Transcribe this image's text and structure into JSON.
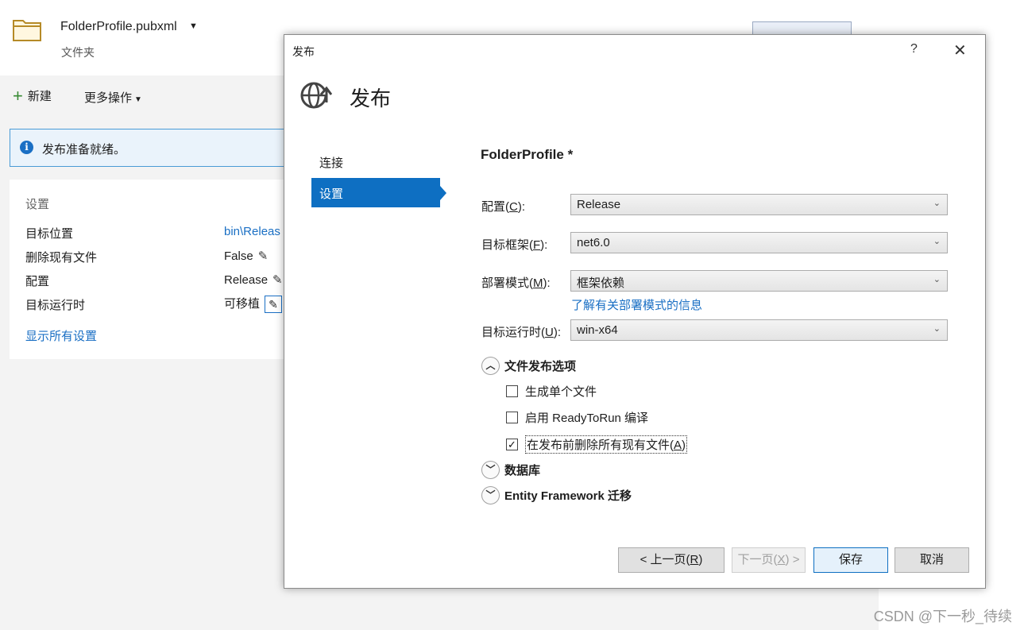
{
  "background": {
    "profile_name": "FolderProfile.pubxml",
    "profile_type": "文件夹",
    "toolbar": {
      "new_label": "新建",
      "more_label": "更多操作"
    },
    "info_message": "发布准备就绪。",
    "settings": {
      "title": "设置",
      "rows": [
        {
          "label": "目标位置",
          "value": "bin\\Releas"
        },
        {
          "label": "删除现有文件",
          "value": "False"
        },
        {
          "label": "配置",
          "value": "Release"
        },
        {
          "label": "目标运行时",
          "value": "可移植"
        }
      ],
      "show_all": "显示所有设置"
    }
  },
  "dialog": {
    "title": "发布",
    "help": "?",
    "close": "✕",
    "heading": "发布",
    "nav": {
      "connection": "连接",
      "settings": "设置"
    },
    "form_title": "FolderProfile *",
    "fields": {
      "config": {
        "label_pre": "配置(",
        "label_key": "C",
        "label_post": "):",
        "value": "Release"
      },
      "framework": {
        "label_pre": "目标框架(",
        "label_key": "F",
        "label_post": "):",
        "value": "net6.0"
      },
      "deploy_mode": {
        "label_pre": "部署模式(",
        "label_key": "M",
        "label_post": "):",
        "value": "框架依赖"
      },
      "runtime": {
        "label_pre": "目标运行时(",
        "label_key": "U",
        "label_post": "):",
        "value": "win-x64"
      }
    },
    "learn_link": "了解有关部署模式的信息",
    "sections": {
      "file_publish": "文件发布选项",
      "database": "数据库",
      "ef_migrations": "Entity Framework 迁移"
    },
    "checkboxes": {
      "single_file": {
        "label": "生成单个文件",
        "checked": false
      },
      "ready_to_run": {
        "label": "启用 ReadyToRun 编译",
        "checked": false
      },
      "delete_existing": {
        "label_pre": "在发布前删除所有现有文件(",
        "label_key": "A",
        "label_post": ")",
        "checked": true
      }
    },
    "buttons": {
      "prev_pre": "< 上一页(",
      "prev_key": "R",
      "prev_post": ")",
      "next_pre": "下一页(",
      "next_key": "X",
      "next_post": ") >",
      "save": "保存",
      "cancel": "取消"
    }
  },
  "watermark": "CSDN @下一秒_待续",
  "colors": {
    "accent": "#0e6fc2",
    "link": "#1a6fc4",
    "info_bg": "#eaf3fb"
  }
}
